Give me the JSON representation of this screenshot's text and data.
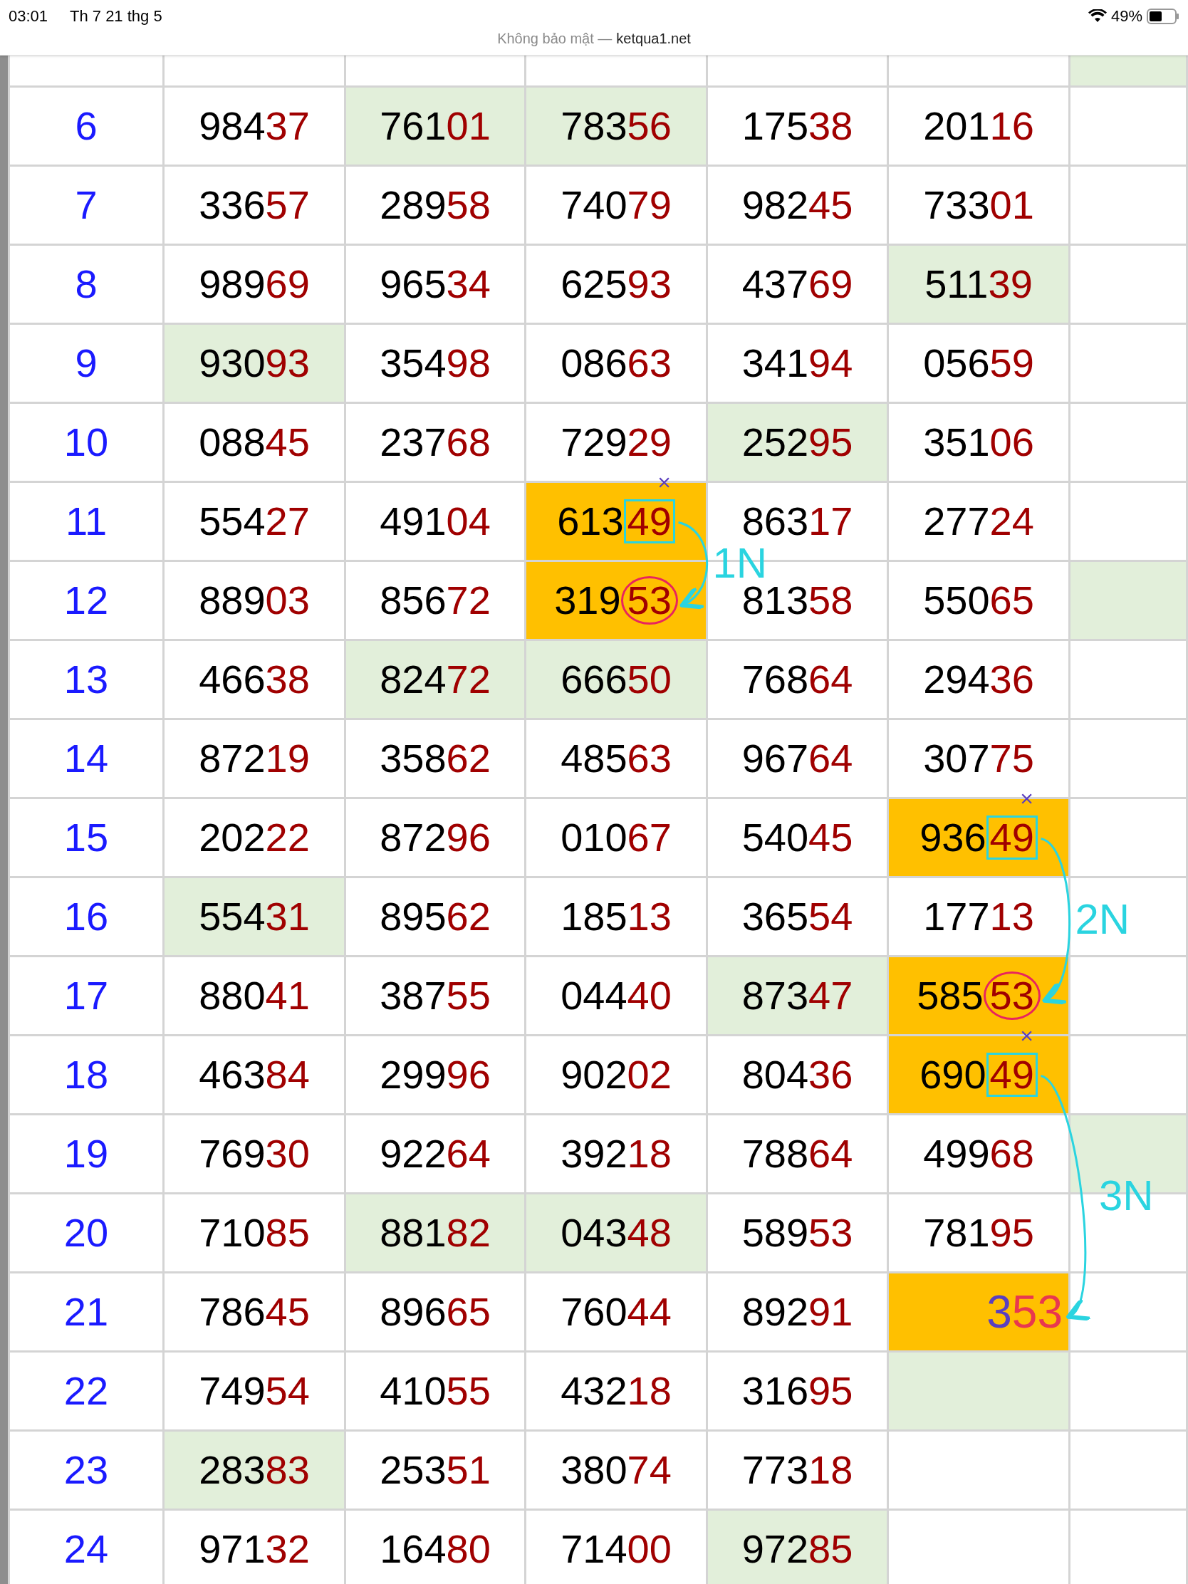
{
  "status_bar": {
    "time": "03:01",
    "date": "Th 7 21 thg 5",
    "battery": "49%"
  },
  "address_bar": {
    "security": "Không bảo mật —",
    "domain": "ketqua1.net"
  },
  "cut_row": {
    "cells": [
      {},
      {},
      {},
      {},
      {},
      {
        "color": "#e2efda"
      }
    ]
  },
  "rows": [
    {
      "label": "6",
      "cells": [
        {
          "lead": "984",
          "tail": "37"
        },
        {
          "lead": "761",
          "tail": "01",
          "color": "#e2efda"
        },
        {
          "lead": "783",
          "tail": "56",
          "color": "#e2efda"
        },
        {
          "lead": "175",
          "tail": "38"
        },
        {
          "lead": "201",
          "tail": "16"
        },
        {}
      ]
    },
    {
      "label": "7",
      "cells": [
        {
          "lead": "336",
          "tail": "57"
        },
        {
          "lead": "289",
          "tail": "58"
        },
        {
          "lead": "740",
          "tail": "79"
        },
        {
          "lead": "982",
          "tail": "45"
        },
        {
          "lead": "733",
          "tail": "01"
        },
        {}
      ]
    },
    {
      "label": "8",
      "cells": [
        {
          "lead": "989",
          "tail": "69"
        },
        {
          "lead": "965",
          "tail": "34"
        },
        {
          "lead": "625",
          "tail": "93"
        },
        {
          "lead": "437",
          "tail": "69"
        },
        {
          "lead": "511",
          "tail": "39",
          "color": "#e2efda"
        },
        {}
      ]
    },
    {
      "label": "9",
      "cells": [
        {
          "lead": "930",
          "tail": "93",
          "color": "#e2efda"
        },
        {
          "lead": "354",
          "tail": "98"
        },
        {
          "lead": "086",
          "tail": "63"
        },
        {
          "lead": "341",
          "tail": "94"
        },
        {
          "lead": "056",
          "tail": "59"
        },
        {}
      ]
    },
    {
      "label": "10",
      "cells": [
        {
          "lead": "088",
          "tail": "45"
        },
        {
          "lead": "237",
          "tail": "68"
        },
        {
          "lead": "729",
          "tail": "29"
        },
        {
          "lead": "252",
          "tail": "95",
          "color": "#e2efda"
        },
        {
          "lead": "351",
          "tail": "06"
        },
        {}
      ]
    },
    {
      "label": "11",
      "cells": [
        {
          "lead": "554",
          "tail": "27"
        },
        {
          "lead": "491",
          "tail": "04"
        },
        {
          "lead": "613",
          "tail": "49",
          "color": "#ffc000",
          "boxed": true,
          "cross": "×",
          "arrow_label": "1N"
        },
        {
          "lead": "863",
          "tail": "17"
        },
        {
          "lead": "277",
          "tail": "24"
        },
        {}
      ]
    },
    {
      "label": "12",
      "cells": [
        {
          "lead": "889",
          "tail": "03"
        },
        {
          "lead": "856",
          "tail": "72"
        },
        {
          "lead": "319",
          "tail": "53",
          "color": "#ffc000",
          "circled": true
        },
        {
          "lead": "813",
          "tail": "58"
        },
        {
          "lead": "550",
          "tail": "65"
        },
        {
          "color": "#e2efda"
        }
      ]
    },
    {
      "label": "13",
      "cells": [
        {
          "lead": "466",
          "tail": "38"
        },
        {
          "lead": "824",
          "tail": "72",
          "color": "#e2efda"
        },
        {
          "lead": "666",
          "tail": "50",
          "color": "#e2efda"
        },
        {
          "lead": "768",
          "tail": "64"
        },
        {
          "lead": "294",
          "tail": "36"
        },
        {}
      ]
    },
    {
      "label": "14",
      "cells": [
        {
          "lead": "872",
          "tail": "19"
        },
        {
          "lead": "358",
          "tail": "62"
        },
        {
          "lead": "485",
          "tail": "63"
        },
        {
          "lead": "967",
          "tail": "64"
        },
        {
          "lead": "307",
          "tail": "75"
        },
        {}
      ]
    },
    {
      "label": "15",
      "cells": [
        {
          "lead": "202",
          "tail": "22"
        },
        {
          "lead": "872",
          "tail": "96"
        },
        {
          "lead": "010",
          "tail": "67"
        },
        {
          "lead": "540",
          "tail": "45"
        },
        {
          "lead": "936",
          "tail": "49",
          "color": "#ffc000",
          "boxed": true,
          "cross": "×",
          "arrow_label": "2N"
        },
        {}
      ]
    },
    {
      "label": "16",
      "cells": [
        {
          "lead": "554",
          "tail": "31",
          "color": "#e2efda"
        },
        {
          "lead": "895",
          "tail": "62"
        },
        {
          "lead": "185",
          "tail": "13"
        },
        {
          "lead": "365",
          "tail": "54"
        },
        {
          "lead": "177",
          "tail": "13"
        },
        {}
      ]
    },
    {
      "label": "17",
      "cells": [
        {
          "lead": "880",
          "tail": "41"
        },
        {
          "lead": "387",
          "tail": "55"
        },
        {
          "lead": "044",
          "tail": "40"
        },
        {
          "lead": "873",
          "tail": "47",
          "color": "#e2efda"
        },
        {
          "lead": "585",
          "tail": "53",
          "color": "#ffc000",
          "circled": true
        },
        {}
      ]
    },
    {
      "label": "18",
      "cells": [
        {
          "lead": "463",
          "tail": "84"
        },
        {
          "lead": "299",
          "tail": "96"
        },
        {
          "lead": "902",
          "tail": "02"
        },
        {
          "lead": "804",
          "tail": "36"
        },
        {
          "lead": "690",
          "tail": "49",
          "color": "#ffc000",
          "boxed": true,
          "cross": "×",
          "arrow_label": "3N"
        },
        {}
      ]
    },
    {
      "label": "19",
      "cells": [
        {
          "lead": "769",
          "tail": "30"
        },
        {
          "lead": "922",
          "tail": "64"
        },
        {
          "lead": "392",
          "tail": "18"
        },
        {
          "lead": "788",
          "tail": "64"
        },
        {
          "lead": "499",
          "tail": "68"
        },
        {
          "color": "#e2efda"
        }
      ]
    },
    {
      "label": "20",
      "cells": [
        {
          "lead": "710",
          "tail": "85"
        },
        {
          "lead": "881",
          "tail": "82",
          "color": "#e2efda"
        },
        {
          "lead": "043",
          "tail": "48",
          "color": "#e2efda"
        },
        {
          "lead": "589",
          "tail": "53"
        },
        {
          "lead": "781",
          "tail": "95"
        },
        {}
      ]
    },
    {
      "label": "21",
      "cells": [
        {
          "lead": "786",
          "tail": "45"
        },
        {
          "lead": "896",
          "tail": "65"
        },
        {
          "lead": "760",
          "tail": "44"
        },
        {
          "lead": "892",
          "tail": "91"
        },
        {
          "lead": "3",
          "tail": "53",
          "color": "#ffc000",
          "handwritten": true
        },
        {}
      ]
    },
    {
      "label": "22",
      "cells": [
        {
          "lead": "749",
          "tail": "54"
        },
        {
          "lead": "410",
          "tail": "55"
        },
        {
          "lead": "432",
          "tail": "18"
        },
        {
          "lead": "316",
          "tail": "95"
        },
        {
          "color": "#e2efda"
        },
        {}
      ]
    },
    {
      "label": "23",
      "cells": [
        {
          "lead": "283",
          "tail": "83",
          "color": "#e2efda"
        },
        {
          "lead": "253",
          "tail": "51"
        },
        {
          "lead": "380",
          "tail": "74"
        },
        {
          "lead": "773",
          "tail": "18"
        },
        {},
        {}
      ]
    },
    {
      "label": "24",
      "cells": [
        {
          "lead": "971",
          "tail": "32"
        },
        {
          "lead": "164",
          "tail": "80"
        },
        {
          "lead": "714",
          "tail": "00"
        },
        {
          "lead": "972",
          "tail": "85",
          "color": "#e2efda"
        },
        {},
        {}
      ]
    }
  ]
}
